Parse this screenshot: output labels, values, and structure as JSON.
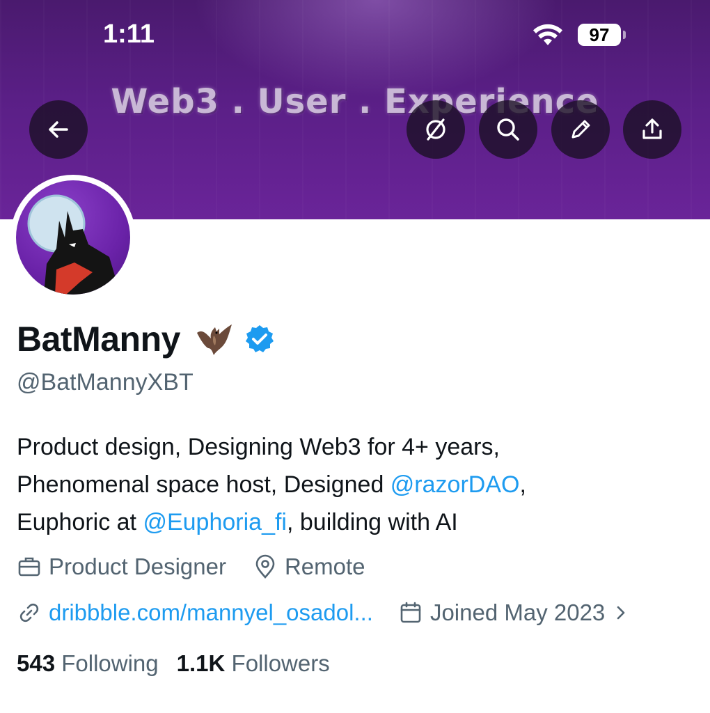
{
  "status_bar": {
    "time": "1:11",
    "battery": "97"
  },
  "banner": {
    "title": "Web3 . User . Experience"
  },
  "actions": {
    "back": "back-arrow-icon",
    "grok": "grok-icon",
    "search": "search-icon",
    "edit": "pencil-icon",
    "share": "share-icon"
  },
  "profile": {
    "display_name": "BatManny",
    "handle": "@BatMannyXBT",
    "bio": {
      "line1": "Product design, Designing Web3 for 4+ years,",
      "line2_text": "Phenomenal space host, Designed ",
      "line2_mention": "@razorDAO",
      "line2_tail": ",",
      "line3_text": "Euphoric at ",
      "line3_mention": "@Euphoria_fi",
      "line3_tail": ", building with AI"
    },
    "profession": "Product Designer",
    "location": "Remote",
    "website": "dribbble.com/mannyel_osadol...",
    "joined": "Joined May 2023",
    "following_count": "543",
    "following_label": "Following",
    "followers_count": "1.1K",
    "followers_label": "Followers"
  },
  "colors": {
    "link": "#1d9bf0",
    "secondary_text": "#536471",
    "banner": "#5a1f86"
  }
}
